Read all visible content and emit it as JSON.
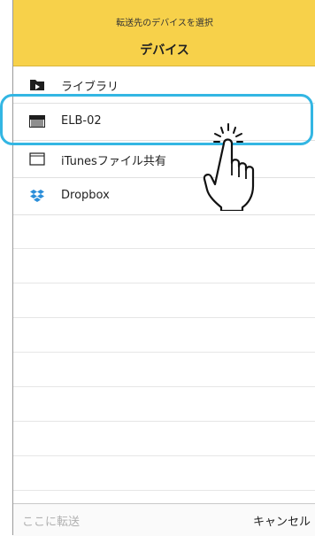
{
  "header": {
    "subtitle": "転送先のデバイスを選択",
    "title": "デバイス"
  },
  "items": [
    {
      "label": "ライブラリ",
      "icon": "library-folder-icon"
    },
    {
      "label": "ELB-02",
      "icon": "keyboard-device-icon"
    },
    {
      "label": "iTunesファイル共有",
      "icon": "file-share-icon"
    },
    {
      "label": "Dropbox",
      "icon": "dropbox-icon"
    }
  ],
  "footer": {
    "transfer_here": "ここに転送",
    "cancel": "キャンセル"
  },
  "colors": {
    "header_bg": "#f7d14a",
    "highlight": "#33b6e3"
  },
  "overlay": {
    "pointer_icon": "tap-hand-icon"
  }
}
